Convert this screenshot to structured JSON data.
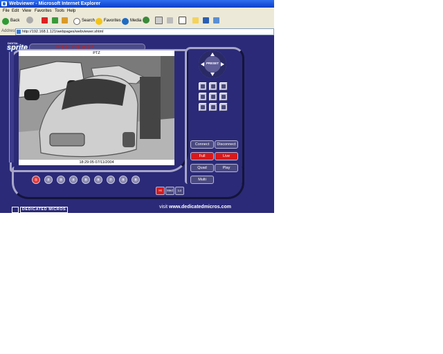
{
  "browser": {
    "title": "Webviewer - Microsoft Internet Explorer",
    "menu": [
      "File",
      "Edit",
      "View",
      "Favorites",
      "Tools",
      "Help"
    ],
    "toolbar": {
      "back": "Back",
      "search": "Search",
      "favorites": "Favorites",
      "media": "Media"
    },
    "address_label": "Address",
    "address": "http://192.168.1.121/webpages/webviewer.shtml"
  },
  "app": {
    "logo_top": "DIGITAL",
    "logo": "sprite",
    "title_banner": "WEB VIEWER",
    "ptz_label": "PTZ",
    "timestamp": "18:29:05 07/11/2004",
    "preset_label": "PRESET",
    "buttons": {
      "connect": "Connect",
      "disconnect": "Disconnect",
      "full": "Full",
      "live": "Live",
      "quad": "Quad",
      "play": "Play",
      "multi": "Multi"
    },
    "channels": [
      "1",
      "2",
      "3",
      "4",
      "5",
      "6",
      "7",
      "8",
      "9"
    ],
    "resolution": [
      "Hi",
      "Med",
      "Lo"
    ],
    "footer_logo": "DEDICATED MICROS",
    "visit_prefix": "visit ",
    "visit_url": "www.dedicatedmicros.com"
  },
  "colors": {
    "panel_bg": "#2b2a78",
    "active_red": "#d8191b",
    "ie_chrome": "#ece9d8"
  }
}
